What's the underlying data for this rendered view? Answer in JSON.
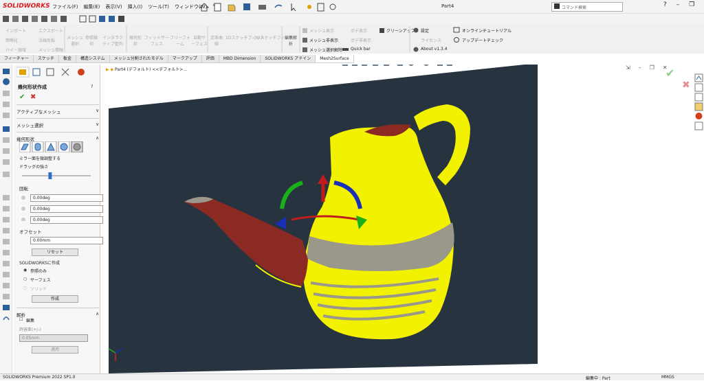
{
  "app": {
    "logo_text": "SOLIDWORKS",
    "doc_title": "Part4",
    "search_placeholder": "コマンド検索"
  },
  "menu": [
    "ファイル(F)",
    "編集(E)",
    "表示(V)",
    "挿入(I)",
    "ツール(T)",
    "ウィンドウ(W)"
  ],
  "command_manager": {
    "group1": [
      "インポート",
      "エクスポート",
      "簡略化",
      "法線反転",
      "ハイ・領域",
      "メッシュ情報"
    ],
    "group2": [
      "メッシュ選択",
      "参照幾何",
      "インタラクティブ整列"
    ],
    "group3": [
      "幾何形状",
      "フィットサーフェス",
      "フリーフォーム",
      "自動サーフェス"
    ],
    "group4": [
      "交差曲線",
      "2Dスケッチフィット",
      "3Dスケッチフィット"
    ],
    "group5": [
      "編集解析"
    ],
    "group6": [
      "メッシュ表示",
      "メッシュ非表示",
      "メッシュ選択解除",
      "ポデ表示",
      "ポデ非表示"
    ],
    "cleanup": "クリーンアップ",
    "quickbar": "Quick bar",
    "settings": "設定",
    "license": "ライセンス",
    "about": "About v1.3.4",
    "tutorial": "オンラインチュートリアル",
    "update": "アップデートチェック"
  },
  "tabs": [
    "フィーチャー",
    "スケッチ",
    "板金",
    "構造システム",
    "メッシュ分割されたモデル",
    "マークアップ",
    "評価",
    "MBD Dimension",
    "SOLIDWORKS アドイン",
    "Mesh2Surface"
  ],
  "active_tab": "Mesh2Surface",
  "property_manager": {
    "title": "幾何形状作成",
    "active_mesh": "アクティブなメッシュ",
    "mesh_select": "メッシュ選択",
    "geometry": "幾何形状",
    "mirror_label": "ミラー面を微調整する",
    "drag_strength": "ドラッグの強さ",
    "rotation": "回転",
    "rot_values": [
      "0.00deg",
      "0.00deg",
      "0.00deg"
    ],
    "offset": "オフセット",
    "offset_value": "0.00mm",
    "reset": "リセット",
    "create_as": "SOLIDWORKSに作成",
    "options": [
      "参照のみ",
      "サーフェス",
      "ソリッド"
    ],
    "create_btn": "作成",
    "analysis": "解析",
    "edit": "編集",
    "tolerance": "許容差(+/-)",
    "tolerance_value": "0.05mm",
    "apply": "適用",
    "drag_level": 0.4
  },
  "viewport": {
    "tree_label": "Part4 (デフォルト) <<デフォルト>..."
  },
  "status": {
    "left": "SOLIDWORKS Premium 2022 SP1.0",
    "edit": "編集中 : Part",
    "units": "MMGS"
  },
  "colors": {
    "bg_panel": "#27343f",
    "mesh_yellow": "#f2f200",
    "mesh_red": "#8b2a23",
    "mesh_gray": "#9a978b",
    "accent_red": "#d71920"
  }
}
